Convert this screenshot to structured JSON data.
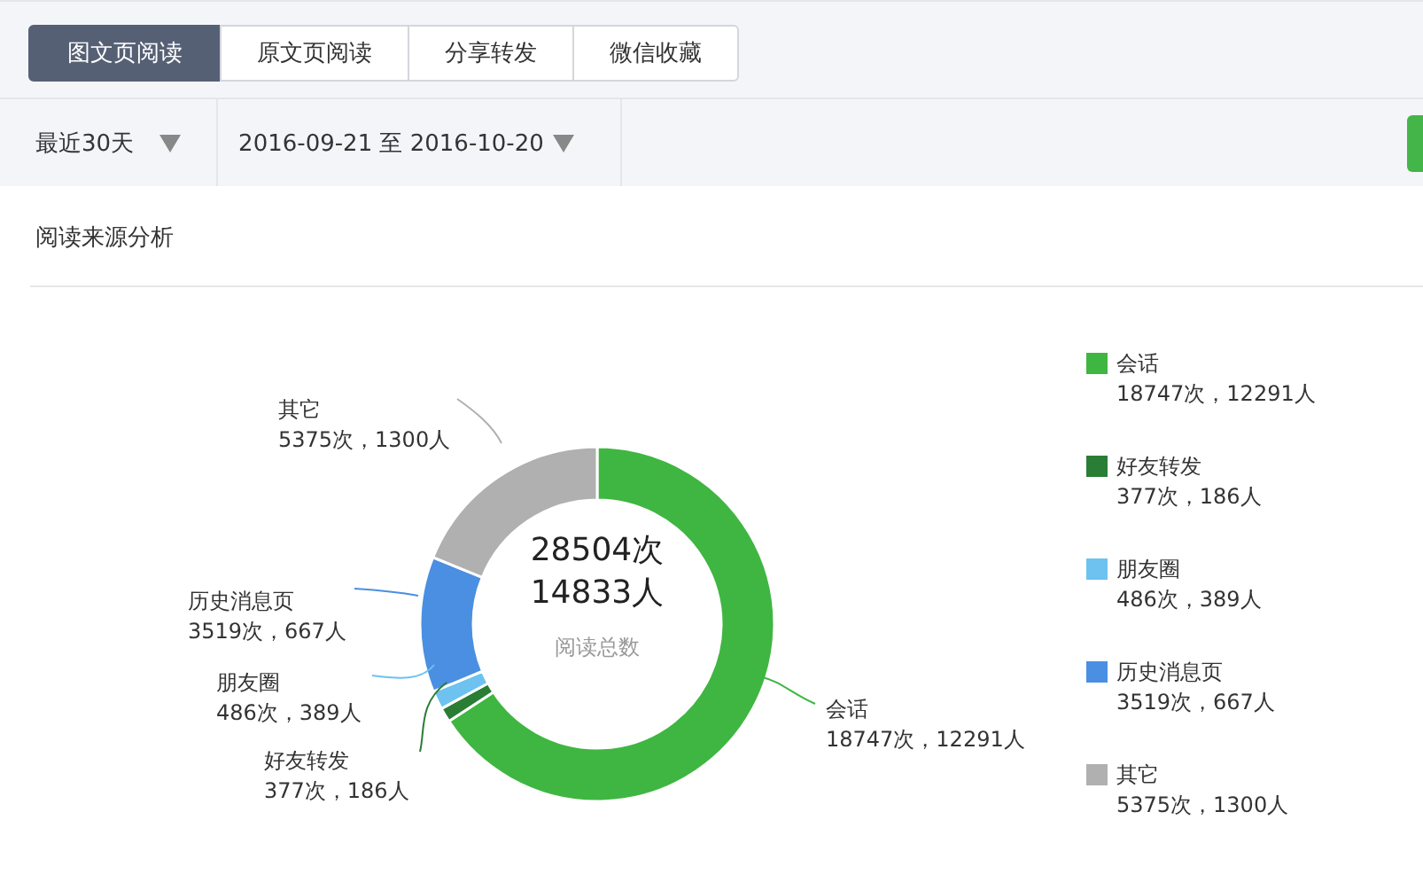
{
  "tabs": [
    {
      "label": "图文页阅读",
      "selected": true
    },
    {
      "label": "原文页阅读",
      "selected": false
    },
    {
      "label": "分享转发",
      "selected": false
    },
    {
      "label": "微信收藏",
      "selected": false
    }
  ],
  "filters": {
    "period": "最近30天",
    "date_range": "2016-09-21 至 2016-10-20"
  },
  "section_title": "阅读来源分析",
  "center": {
    "count": "28504次",
    "people": "14833人",
    "caption": "阅读总数"
  },
  "chart_data": {
    "type": "donut",
    "values": [
      65.77,
      1.32,
      1.7,
      12.35,
      18.86
    ]
  },
  "callouts": [
    {
      "name": "其它",
      "stats": "5375次，1300人",
      "color": "#b0b0b0"
    },
    {
      "name": "历史消息页",
      "stats": "3519次，667人",
      "color": "#4a8fe2"
    },
    {
      "name": "朋友圈",
      "stats": "486次，389人",
      "color": "#6dc2f0"
    },
    {
      "name": "会话",
      "stats": "18747次，12291人",
      "color": "#3fb641"
    },
    {
      "name": "好友转发",
      "stats": "377次，186人",
      "color": "#2a7d35"
    }
  ],
  "legend": [
    {
      "name": "会话",
      "stats": "18747次，12291人",
      "color": "#3fb641"
    },
    {
      "name": "好友转发",
      "stats": "377次，186人",
      "color": "#2a7d35"
    },
    {
      "name": "朋友圈",
      "stats": "486次，389人",
      "color": "#6dc2f0"
    },
    {
      "name": "历史消息页",
      "stats": "3519次，667人",
      "color": "#4a8fe2"
    },
    {
      "name": "其它",
      "stats": "5375次，1300人",
      "color": "#b0b0b0"
    }
  ]
}
